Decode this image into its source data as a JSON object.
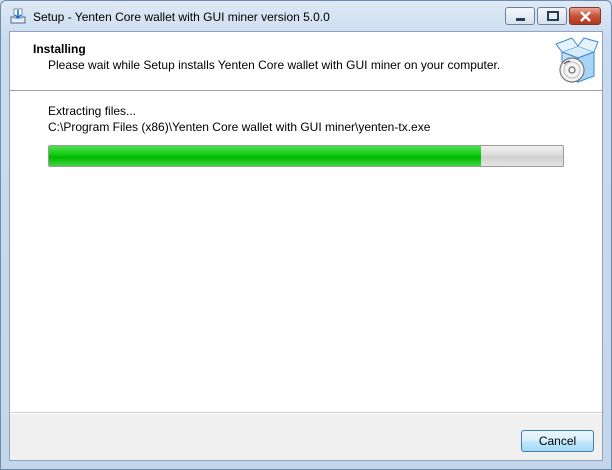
{
  "window": {
    "title": "Setup - Yenten Core wallet with GUI miner version 5.0.0",
    "controls": [
      "minimize",
      "maximize",
      "close"
    ]
  },
  "header": {
    "title": "Installing",
    "subtitle": "Please wait while Setup installs Yenten Core wallet with GUI miner on your computer.",
    "icon": "installer-box-disc-icon"
  },
  "status": {
    "line1": "Extracting files...",
    "line2": "C:\\Program Files (x86)\\Yenten Core wallet with GUI miner\\yenten-tx.exe"
  },
  "progress": {
    "fraction": 0.84,
    "color": "#00b800"
  },
  "footer": {
    "cancel_label": "Cancel"
  }
}
